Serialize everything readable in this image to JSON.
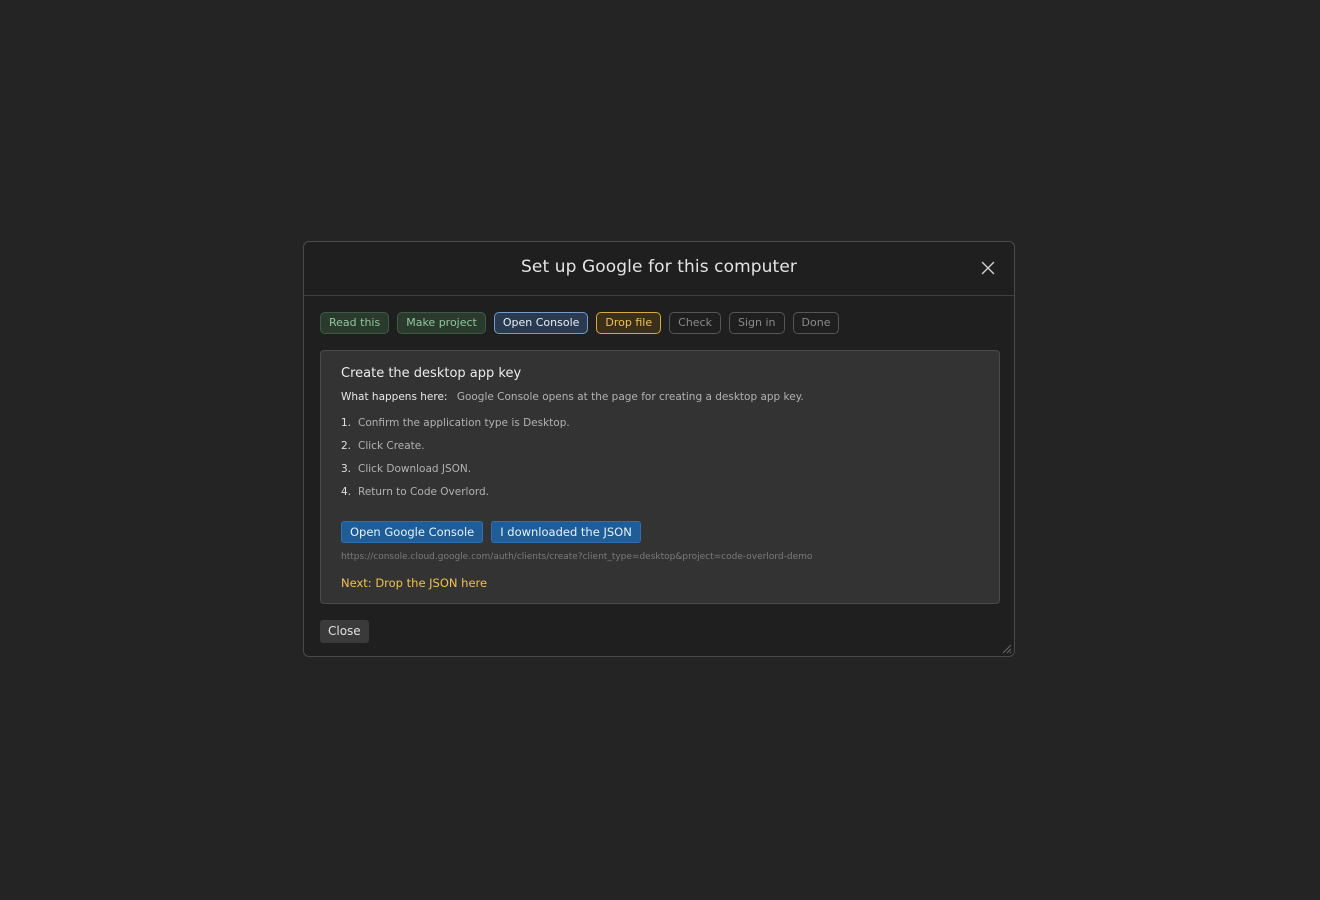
{
  "dialog": {
    "title": "Set up Google for this computer",
    "close_icon": "close-icon",
    "close_label": "Close"
  },
  "steps": [
    {
      "label": "Read this",
      "state": "done"
    },
    {
      "label": "Make project",
      "state": "done"
    },
    {
      "label": "Open Console",
      "state": "active"
    },
    {
      "label": "Drop file",
      "state": "next"
    },
    {
      "label": "Check",
      "state": "pending"
    },
    {
      "label": "Sign in",
      "state": "pending"
    },
    {
      "label": "Done",
      "state": "pending"
    }
  ],
  "panel": {
    "title": "Create the desktop app key",
    "what_label": "What happens here:",
    "what_text": "Google Console opens at the page for creating a desktop app key.",
    "instructions": [
      {
        "num": "1.",
        "text": "Confirm the application type is Desktop."
      },
      {
        "num": "2.",
        "text": "Click Create."
      },
      {
        "num": "3.",
        "text": "Click Download JSON."
      },
      {
        "num": "4.",
        "text": "Return to Code Overlord."
      }
    ],
    "open_console_label": "Open Google Console",
    "downloaded_label": "I downloaded the JSON",
    "url": "https://console.cloud.google.com/auth/clients/create?client_type=desktop&project=code-overlord-demo",
    "next_hint": "Next: Drop the JSON here"
  },
  "colors": {
    "accent": "#1f5d99",
    "done": "#8fc79a",
    "active": "#6e9bd0",
    "next": "#f0c14d",
    "background": "#242424"
  }
}
